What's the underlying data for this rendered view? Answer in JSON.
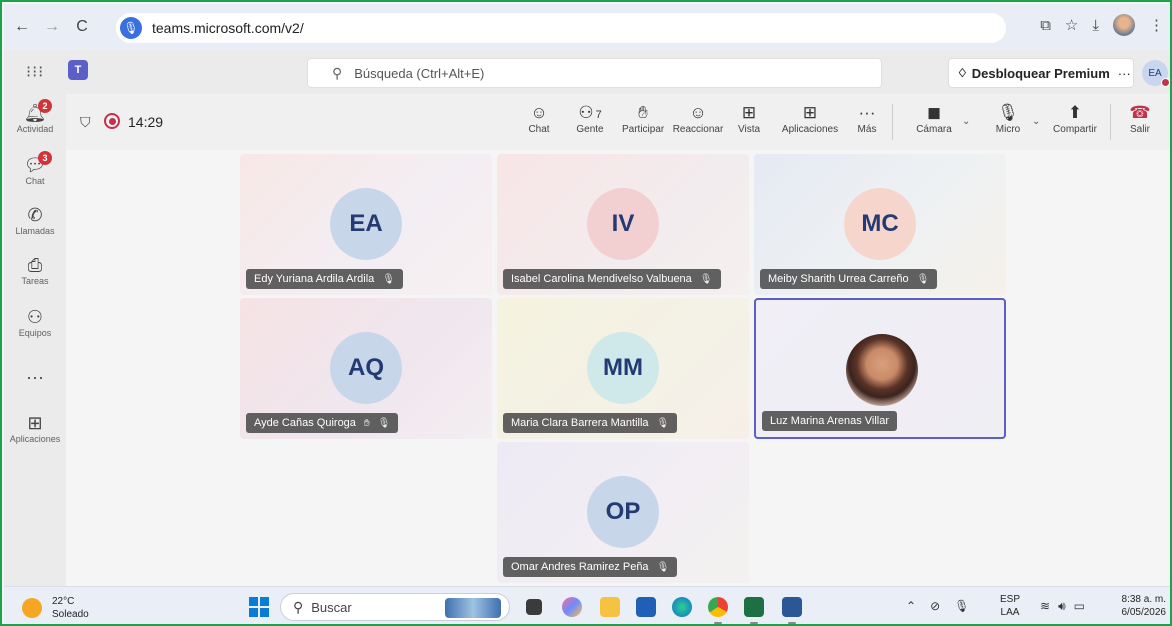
{
  "browser": {
    "url": "teams.microsoft.com/v2/",
    "back_icon": "←",
    "forward_icon": "→",
    "reload_icon": "C"
  },
  "teams_bar": {
    "search_placeholder": "Búsqueda (Ctrl+Alt+E)",
    "premium_label": "Desbloquear Premium",
    "more_dots": "···",
    "user_initials": "EA"
  },
  "rail": {
    "items": [
      {
        "label": "Actividad",
        "badge": "2"
      },
      {
        "label": "Chat",
        "badge": "3"
      },
      {
        "label": "Llamadas"
      },
      {
        "label": "Tareas"
      },
      {
        "label": "Equipos"
      },
      {
        "label": "···"
      },
      {
        "label": "Aplicaciones"
      }
    ]
  },
  "meeting": {
    "timer": "14:29",
    "people_count": "7",
    "buttons": {
      "chat": "Chat",
      "people": "Gente",
      "raise": "Participar",
      "react": "Reaccionar",
      "view": "Vista",
      "apps": "Aplicaciones",
      "more": "Más",
      "camera": "Cámara",
      "mic": "Micro",
      "share": "Compartir",
      "leave": "Salir"
    }
  },
  "participants": [
    {
      "initials": "EA",
      "name": "Edy Yuriana Ardila Ardila"
    },
    {
      "initials": "IV",
      "name": "Isabel Carolina Mendivelso Valbuena"
    },
    {
      "initials": "MC",
      "name": "Meiby Sharith Urrea Carreño"
    },
    {
      "initials": "AQ",
      "name": "Ayde Cañas Quiroga"
    },
    {
      "initials": "MM",
      "name": "Maria Clara Barrera Mantilla"
    },
    {
      "initials": "",
      "name": "Luz Marina Arenas Villar"
    },
    {
      "initials": "OP",
      "name": "Omar Andres Ramirez Peña"
    }
  ],
  "colors": {
    "avatar_ea": "#c8d6ea",
    "avatar_iv": "#f2cfd0",
    "avatar_mc": "#f6d6cc",
    "avatar_aq": "#c8d6ea",
    "avatar_mm": "#cfe8ea",
    "avatar_op": "#c8d6ea",
    "accent": "#5b5fc7",
    "leave": "#c4314b"
  },
  "taskbar": {
    "temperature": "22°C",
    "weather": "Soleado",
    "search_label": "Buscar",
    "lang_top": "ESP",
    "lang_bottom": "LAA",
    "time": "8:38 a. m.",
    "date": "6/05/2026"
  }
}
